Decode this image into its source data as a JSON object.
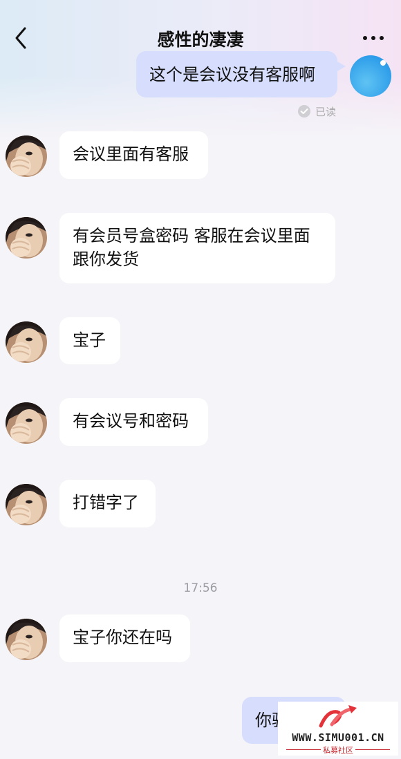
{
  "header": {
    "title": "感性的凄凄"
  },
  "messages": {
    "m0": "这个是会议没有客服啊",
    "m1": "会议里面有客服",
    "m2_line1": "有会员号盒密码 客服在会议里面",
    "m2_line2": "跟你发货",
    "m3": "宝子",
    "m4": "有会议号和密码",
    "m5": "打错字了",
    "m6": "宝子你还在吗",
    "m7": "你骗"
  },
  "read_status": "已读",
  "timestamp": "17:56",
  "watermark": {
    "text": "WWW.SIMU001.CN",
    "sub": "私募社区"
  },
  "colors": {
    "bubble_out": "#d6ddfd",
    "bubble_in": "#ffffff",
    "background": "#f5f4f8",
    "watermark_red": "#c4222a"
  }
}
